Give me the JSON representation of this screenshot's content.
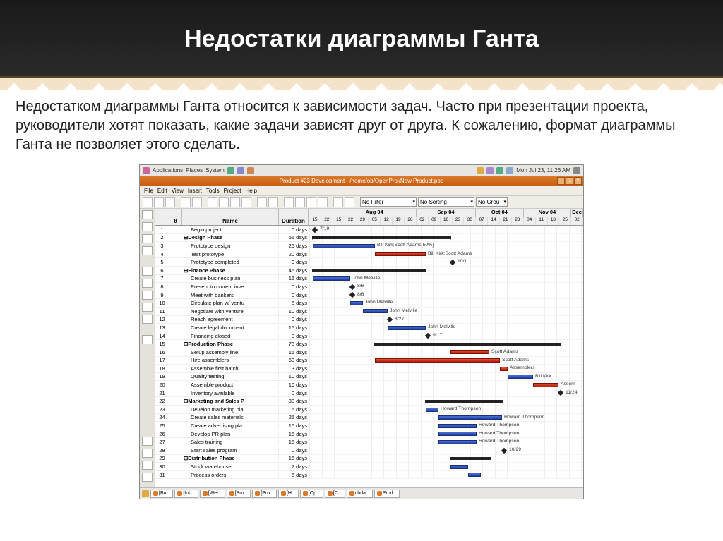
{
  "slide": {
    "title": "Недостатки диаграммы Ганта",
    "body": "Недостатком диаграммы Ганта относится к зависимости задач. Часто при презентации проекта, руководители хотят показать, какие задачи зависят друг от друга. К сожалению, формат диаграммы Ганта не позволяет этого сделать."
  },
  "gnome": {
    "menus": [
      "Applications",
      "Places",
      "System"
    ],
    "clock": "Mon Jul 23, 11:26 AM"
  },
  "window": {
    "title": "Product #23 Development - /home/ob/OpenProj/New Product.pod"
  },
  "menubar": [
    "File",
    "Edit",
    "View",
    "Insert",
    "Tools",
    "Project",
    "Help"
  ],
  "filters": {
    "no_filter": "No Filter",
    "no_sorting": "No Sorting",
    "no_group": "No Grou"
  },
  "columns": {
    "theta": "θ",
    "name": "Name",
    "duration": "Duration"
  },
  "timeline": {
    "months": [
      {
        "label": "Aug 04",
        "weeks": [
          "15",
          "22",
          "29",
          "05",
          "12",
          "19",
          "26"
        ]
      },
      {
        "label": "Sep 04",
        "weeks": [
          "02",
          "09",
          "16",
          "23",
          "30"
        ]
      },
      {
        "label": "Oct 04",
        "weeks": [
          "07",
          "14",
          "21",
          "28"
        ]
      },
      {
        "label": "Nov 04",
        "weeks": [
          "04",
          "11",
          "18",
          "25"
        ]
      },
      {
        "label": "Dec",
        "weeks": [
          "02"
        ]
      }
    ],
    "before": [
      "15",
      "22"
    ]
  },
  "tasks": [
    {
      "n": 1,
      "name": "Begin project",
      "dur": "0 days",
      "bold": false,
      "ind": 1,
      "type": "milestone",
      "s": 0,
      "label": "7/19"
    },
    {
      "n": 2,
      "name": "Design Phase",
      "dur": "55 days",
      "bold": true,
      "ind": 0,
      "type": "black",
      "s": 0,
      "e": 195
    },
    {
      "n": 3,
      "name": "Prototype design",
      "dur": "25 days",
      "bold": false,
      "ind": 1,
      "type": "blue",
      "s": 0,
      "e": 88,
      "label": "Bill Kirk;Scott Adams[50%]"
    },
    {
      "n": 4,
      "name": "Test prototype",
      "dur": "20 days",
      "bold": false,
      "ind": 1,
      "type": "red",
      "s": 88,
      "e": 160,
      "label": "Bill Kirk;Scott Adams"
    },
    {
      "n": 5,
      "name": "Prototype completed",
      "dur": "0 days",
      "bold": false,
      "ind": 1,
      "type": "milestone",
      "s": 195,
      "label": "10/1"
    },
    {
      "n": 6,
      "name": "Finance Phase",
      "dur": "45 days",
      "bold": true,
      "ind": 0,
      "type": "black",
      "s": 0,
      "e": 160
    },
    {
      "n": 7,
      "name": "Create business plan",
      "dur": "15 days",
      "bold": false,
      "ind": 1,
      "type": "blue",
      "s": 0,
      "e": 53,
      "label": "John Melville"
    },
    {
      "n": 8,
      "name": "Present to current inve",
      "dur": "0 days",
      "bold": false,
      "ind": 1,
      "type": "milestone",
      "s": 53,
      "label": "8/6"
    },
    {
      "n": 9,
      "name": "Meet with bankers",
      "dur": "0 days",
      "bold": false,
      "ind": 1,
      "type": "milestone",
      "s": 53,
      "label": "8/6"
    },
    {
      "n": 10,
      "name": "Circulate plan w/ ventu",
      "dur": "5 days",
      "bold": false,
      "ind": 1,
      "type": "blue",
      "s": 53,
      "e": 71,
      "label": "John Melville"
    },
    {
      "n": 11,
      "name": "Negotiate with venture",
      "dur": "10 days",
      "bold": false,
      "ind": 1,
      "type": "blue",
      "s": 71,
      "e": 106,
      "label": "John Melville"
    },
    {
      "n": 12,
      "name": "Reach agreement",
      "dur": "0 days",
      "bold": false,
      "ind": 1,
      "type": "milestone",
      "s": 106,
      "label": "8/27"
    },
    {
      "n": 13,
      "name": "Create legal document",
      "dur": "15 days",
      "bold": false,
      "ind": 1,
      "type": "blue",
      "s": 106,
      "e": 160,
      "label": "John Melville"
    },
    {
      "n": 14,
      "name": "Financing closed",
      "dur": "0 days",
      "bold": false,
      "ind": 1,
      "type": "milestone",
      "s": 160,
      "label": "9/17"
    },
    {
      "n": 15,
      "name": "Production Phase",
      "dur": "73 days",
      "bold": true,
      "ind": 0,
      "type": "black",
      "s": 88,
      "e": 350
    },
    {
      "n": 16,
      "name": "Setup assembly line",
      "dur": "15 days",
      "bold": false,
      "ind": 1,
      "type": "red",
      "s": 195,
      "e": 250,
      "label": "Scott Adams"
    },
    {
      "n": 17,
      "name": "Hire assemblers",
      "dur": "50 days",
      "bold": false,
      "ind": 1,
      "type": "red",
      "s": 88,
      "e": 265,
      "label": "Scott Adams"
    },
    {
      "n": 18,
      "name": "Assemble first batch",
      "dur": "3 days",
      "bold": false,
      "ind": 1,
      "type": "red",
      "s": 265,
      "e": 276,
      "label": "Assemblers"
    },
    {
      "n": 19,
      "name": "Quality testing",
      "dur": "10 days",
      "bold": false,
      "ind": 1,
      "type": "blue",
      "s": 276,
      "e": 312,
      "label": "Bill Kirk"
    },
    {
      "n": 20,
      "name": "Assemble product",
      "dur": "10 days",
      "bold": false,
      "ind": 1,
      "type": "red",
      "s": 312,
      "e": 348,
      "label": "Assem"
    },
    {
      "n": 21,
      "name": "Inventory available",
      "dur": "0 days",
      "bold": false,
      "ind": 1,
      "type": "milestone",
      "s": 348,
      "label": "11/24"
    },
    {
      "n": 22,
      "name": "Marketing and Sales P",
      "dur": "30 days",
      "bold": true,
      "ind": 0,
      "type": "black",
      "s": 160,
      "e": 268
    },
    {
      "n": 23,
      "name": "Develop marketing pla",
      "dur": "5 days",
      "bold": false,
      "ind": 1,
      "type": "blue",
      "s": 160,
      "e": 178,
      "label": "Howard Thompson"
    },
    {
      "n": 24,
      "name": "Create sales materials",
      "dur": "25 days",
      "bold": false,
      "ind": 1,
      "type": "blue",
      "s": 178,
      "e": 268,
      "label": "Howard Thompson"
    },
    {
      "n": 25,
      "name": "Create advertising pla",
      "dur": "15 days",
      "bold": false,
      "ind": 1,
      "type": "blue",
      "s": 178,
      "e": 232,
      "label": "Howard Thompson"
    },
    {
      "n": 26,
      "name": "Develop PR plan",
      "dur": "15 days",
      "bold": false,
      "ind": 1,
      "type": "blue",
      "s": 178,
      "e": 232,
      "label": "Howard Thompson"
    },
    {
      "n": 27,
      "name": "Sales training",
      "dur": "15 days",
      "bold": false,
      "ind": 1,
      "type": "blue",
      "s": 178,
      "e": 232,
      "label": "Howard Thompson"
    },
    {
      "n": 28,
      "name": "Start sales program",
      "dur": "0 days",
      "bold": false,
      "ind": 1,
      "type": "milestone",
      "s": 268,
      "label": "10/29"
    },
    {
      "n": 29,
      "name": "Distribution Phase",
      "dur": "16 days",
      "bold": true,
      "ind": 0,
      "type": "black",
      "s": 195,
      "e": 252
    },
    {
      "n": 30,
      "name": "Stock warehouse",
      "dur": "7 days",
      "bold": false,
      "ind": 1,
      "type": "blue",
      "s": 195,
      "e": 220
    },
    {
      "n": 31,
      "name": "Process orders",
      "dur": "5 days",
      "bold": false,
      "ind": 1,
      "type": "blue",
      "s": 220,
      "e": 238
    }
  ],
  "taskbar": [
    "[Bu...",
    "[Inb...",
    "[Wel...",
    "[Pro...",
    "[Pro...",
    "[H...",
    "[Op...",
    "[C...",
    "chrla...",
    "Prod..."
  ]
}
